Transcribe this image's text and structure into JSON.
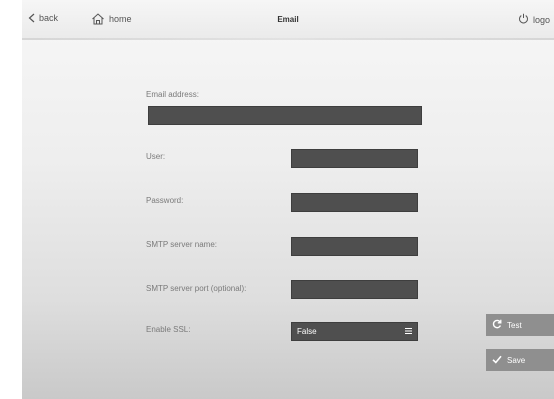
{
  "topbar": {
    "back_label": "back",
    "home_label": "home",
    "title": "Email",
    "logout_label": "logo"
  },
  "form": {
    "email_label": "Email address:",
    "email_value": "",
    "user_label": "User:",
    "user_value": "",
    "password_label": "Password:",
    "password_value": "",
    "smtp_name_label": "SMTP server name:",
    "smtp_name_value": "",
    "smtp_port_label": "SMTP server port (optional):",
    "smtp_port_value": "",
    "ssl_label": "Enable SSL:",
    "ssl_value": "False"
  },
  "actions": {
    "test_label": "Test",
    "save_label": "Save"
  },
  "icons": [
    "chevron-left-icon",
    "home-icon",
    "power-icon",
    "menu-icon",
    "refresh-icon",
    "checkmark-icon"
  ],
  "colors": {
    "field_bg": "#4f4f4f",
    "button_bg": "#8f8f8f",
    "text_label": "#7a7a7a"
  }
}
